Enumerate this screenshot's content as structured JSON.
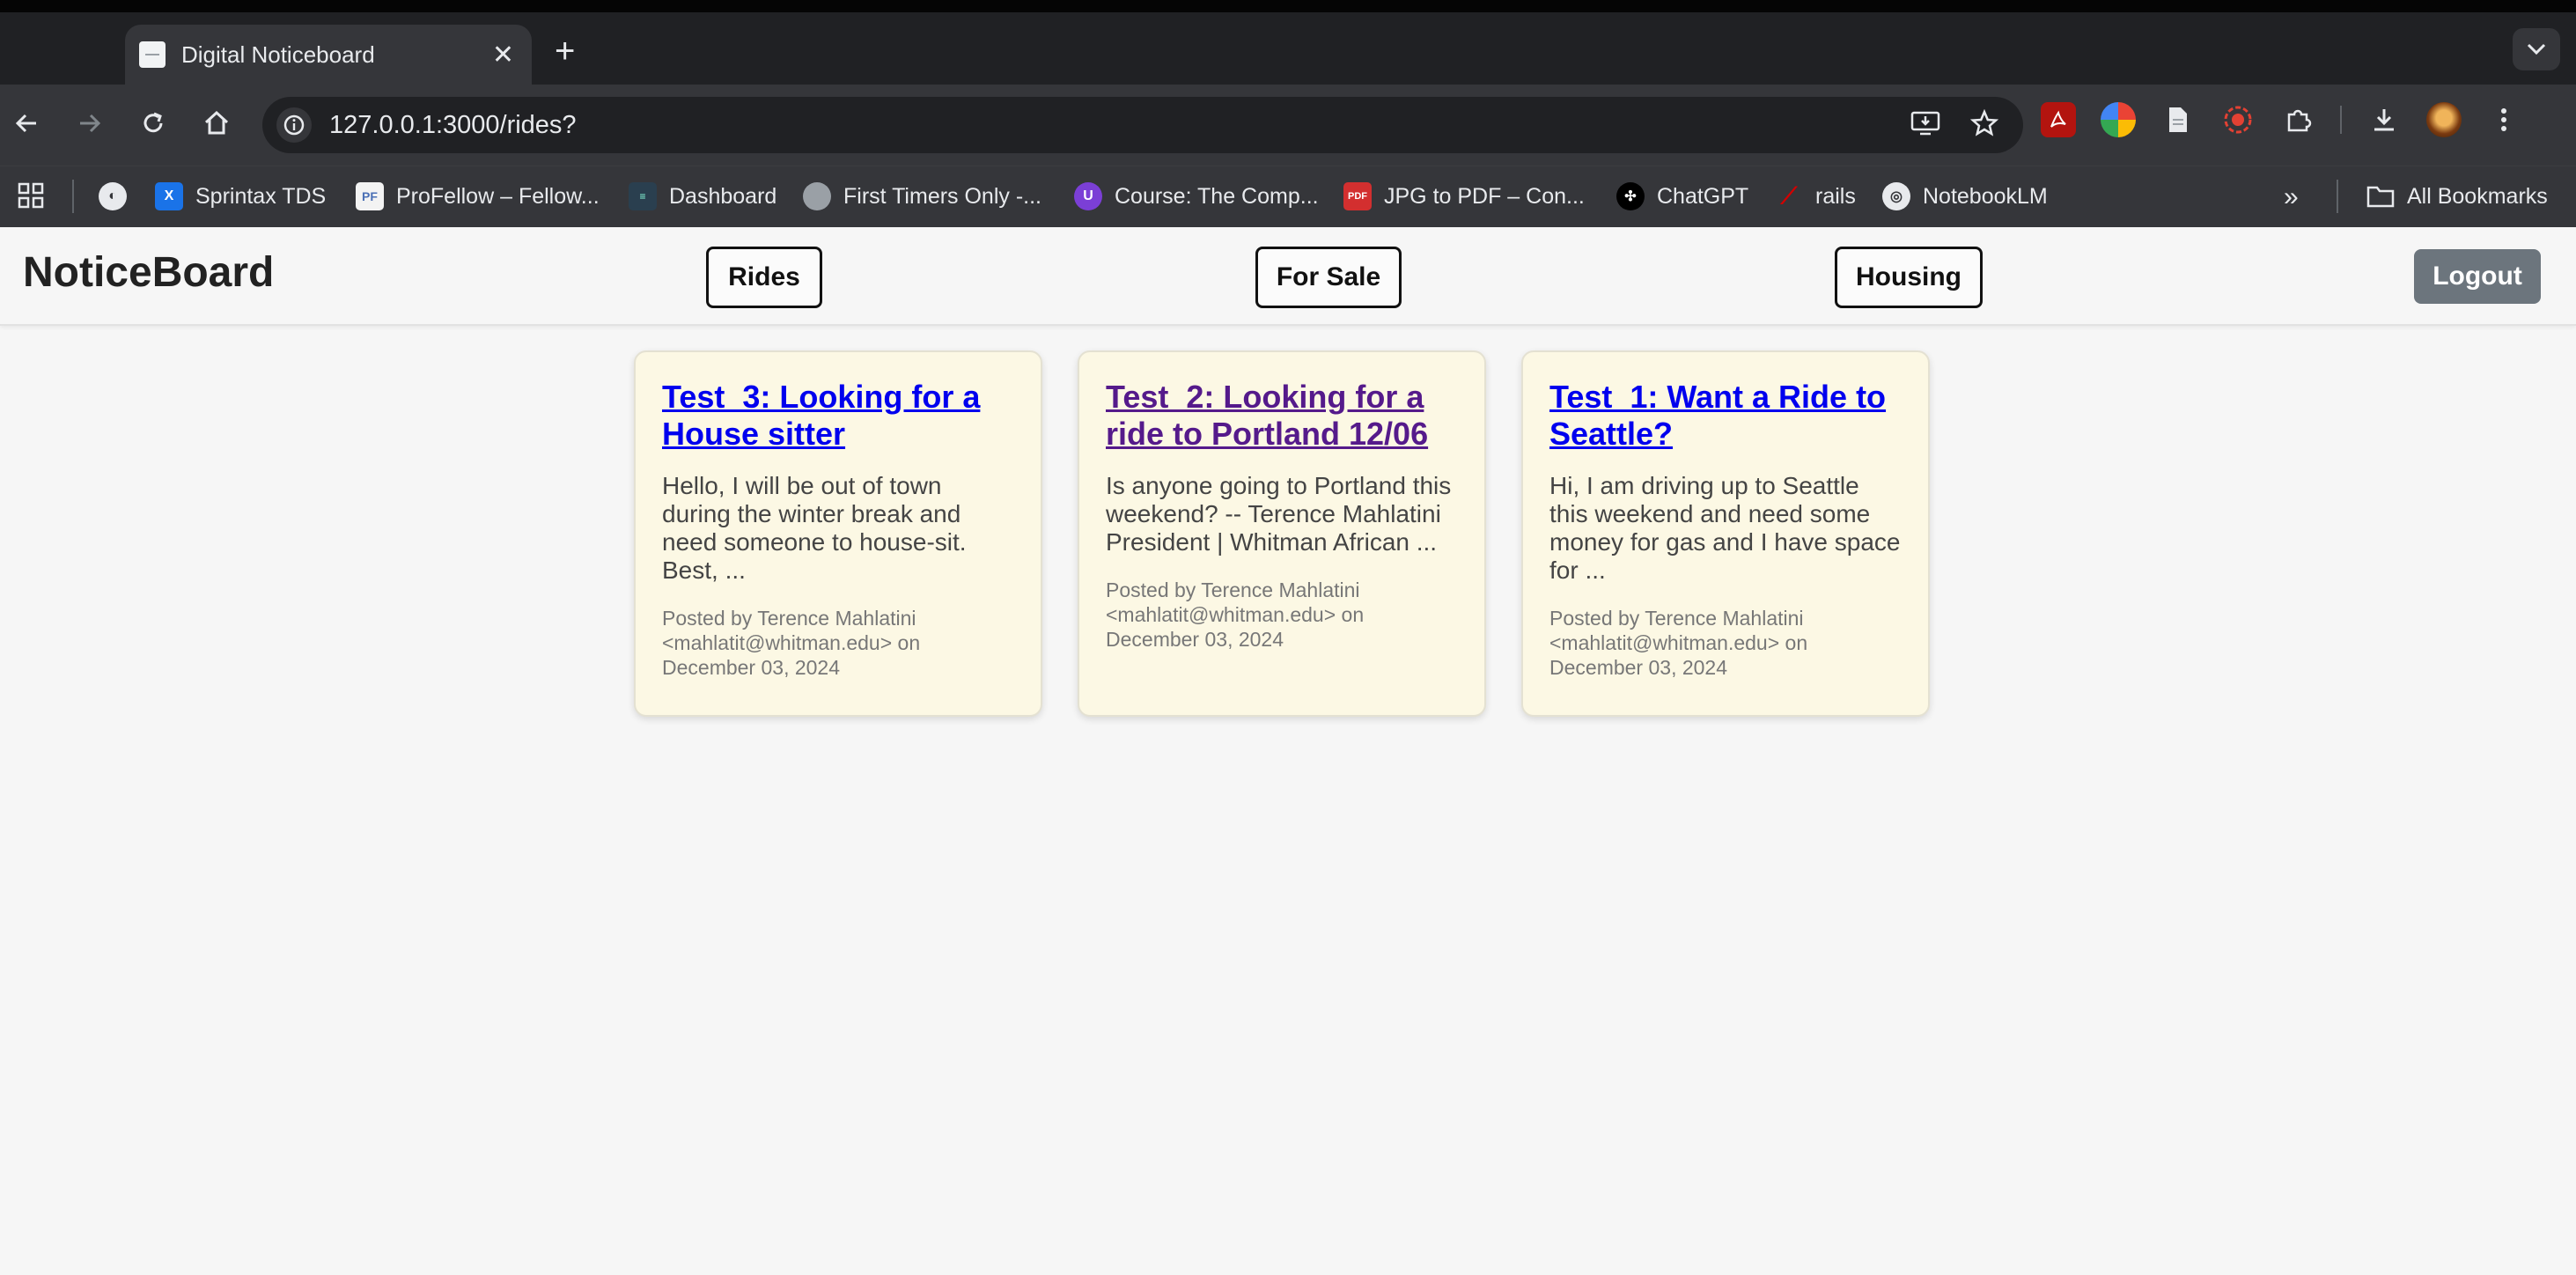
{
  "browser": {
    "tab_title": "Digital Noticeboard",
    "url": "127.0.0.1:3000/rides?",
    "bookmarks": [
      "Sprintax TDS",
      "ProFellow – Fellow...",
      "Dashboard",
      "First Timers Only -...",
      "Course: The Comp...",
      "JPG to PDF – Con...",
      "ChatGPT",
      "rails",
      "NotebookLM"
    ],
    "all_bookmarks": "All Bookmarks"
  },
  "header": {
    "brand": "NoticeBoard",
    "nav": [
      "Rides",
      "For Sale",
      "Housing"
    ],
    "logout": "Logout"
  },
  "posts": [
    {
      "title": "Test_3: Looking for a House sitter",
      "excerpt": "Hello, I will be out of town during the winter break and need someone to house-sit. Best, ...",
      "meta": "Posted by Terence Mahlatini <mahlatit@whitman.edu> on December 03, 2024",
      "visited": false
    },
    {
      "title": "Test_2: Looking for a ride to Portland 12/06",
      "excerpt": "Is anyone going to Portland this weekend? -- Terence Mahlatini President | Whitman African ...",
      "meta": "Posted by Terence Mahlatini <mahlatit@whitman.edu> on December 03, 2024",
      "visited": true
    },
    {
      "title": "Test_1: Want a Ride to Seattle?",
      "excerpt": "Hi, I am driving up to Seattle this weekend and need some money for gas and I have space for ...",
      "meta": "Posted by Terence Mahlatini <mahlatit@whitman.edu> on December 03, 2024",
      "visited": false
    }
  ]
}
